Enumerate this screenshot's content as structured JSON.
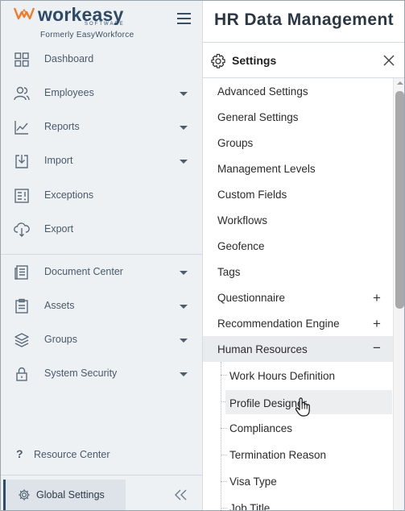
{
  "brand": {
    "name": "workeasy",
    "sub": "SOFTWARE",
    "formerly": "Formerly EasyWorkforce",
    "accent_color": "#f07b2b"
  },
  "header": {
    "title": "HR Data Management"
  },
  "sidebar": {
    "items": [
      {
        "label": "Dashboard",
        "icon": "dashboard-icon",
        "has_caret": false
      },
      {
        "label": "Employees",
        "icon": "users-icon",
        "has_caret": true
      },
      {
        "label": "Reports",
        "icon": "chart-line-icon",
        "has_caret": true
      },
      {
        "label": "Import",
        "icon": "import-icon",
        "has_caret": true
      },
      {
        "label": "Exceptions",
        "icon": "exceptions-icon",
        "has_caret": false
      },
      {
        "label": "Export",
        "icon": "cloud-download-icon",
        "has_caret": false
      },
      {
        "label": "Document Center",
        "icon": "document-icon",
        "has_caret": true
      },
      {
        "label": "Assets",
        "icon": "clipboard-icon",
        "has_caret": true
      },
      {
        "label": "Groups",
        "icon": "layers-icon",
        "has_caret": true
      },
      {
        "label": "System Security",
        "icon": "lock-icon",
        "has_caret": true
      }
    ],
    "resource_center": "Resource Center",
    "global_settings": "Global Settings"
  },
  "settings": {
    "title": "Settings",
    "items": [
      {
        "label": "Advanced Settings"
      },
      {
        "label": "General Settings"
      },
      {
        "label": "Groups"
      },
      {
        "label": "Management Levels"
      },
      {
        "label": "Custom Fields"
      },
      {
        "label": "Workflows"
      },
      {
        "label": "Geofence"
      },
      {
        "label": "Tags"
      },
      {
        "label": "Questionnaire",
        "expander": "+"
      },
      {
        "label": "Recommendation Engine",
        "expander": "+"
      },
      {
        "label": "Human Resources",
        "expander": "−"
      }
    ],
    "sub_items": [
      {
        "label": "Work Hours Definition"
      },
      {
        "label": "Profile Designer"
      },
      {
        "label": "Compliances"
      },
      {
        "label": "Termination Reason"
      },
      {
        "label": "Visa Type"
      },
      {
        "label": "Job Title"
      }
    ]
  },
  "colors": {
    "sidebar_bg": "#eef1f4",
    "brand_navy": "#2f4a66",
    "active_row": "#e9ecef"
  }
}
